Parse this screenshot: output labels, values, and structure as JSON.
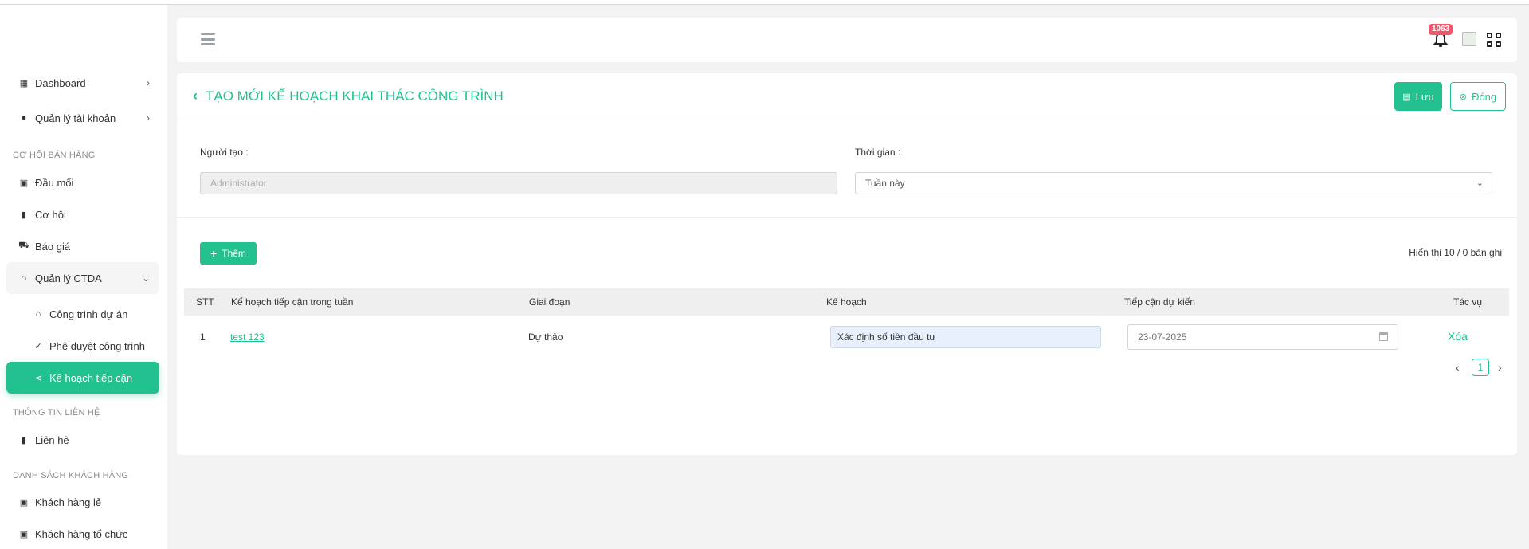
{
  "sidebar": {
    "items": [
      {
        "label": "Dashboard",
        "icon": "dashboard-icon"
      },
      {
        "label": "Quản lý tài khoản",
        "icon": "account-icon"
      }
    ],
    "sections": [
      {
        "title": "CƠ HỘI BÁN HÀNG"
      },
      {
        "title": "THÔNG TIN LIÊN HỆ"
      },
      {
        "title": "DANH SÁCH KHÁCH HÀNG"
      }
    ],
    "sales": [
      {
        "label": "Đầu mối",
        "icon": "contact-card-icon"
      },
      {
        "label": "Cơ hội",
        "icon": "building-icon"
      },
      {
        "label": "Báo giá",
        "icon": "cart-icon"
      },
      {
        "label": "Quản lý CTDA",
        "icon": "home-icon"
      }
    ],
    "ctda_sub": [
      {
        "label": "Công trình dự án",
        "icon": "home-icon"
      },
      {
        "label": "Phê duyệt công trình",
        "icon": "check-circle-icon"
      },
      {
        "label": "Kế hoạch tiếp cận",
        "icon": "share-icon"
      }
    ],
    "contact": [
      {
        "label": "Liên hệ",
        "icon": "building-icon"
      }
    ],
    "customers": [
      {
        "label": "Khách hàng lẻ",
        "icon": "contact-card-icon"
      },
      {
        "label": "Khách hàng tổ chức",
        "icon": "contact-card-icon"
      }
    ]
  },
  "header": {
    "notification_count": "1063"
  },
  "page": {
    "title": "TẠO MỚI KẾ HOẠCH KHAI THÁC CÔNG TRÌNH",
    "save_label": "Lưu",
    "close_label": "Đóng"
  },
  "form": {
    "creator_label": "Người tạo :",
    "creator_placeholder": "Administrator",
    "time_label": "Thời gian :",
    "time_value": "Tuần này"
  },
  "table": {
    "add_label": "Thêm",
    "count_text": "Hiển thị 10 / 0 bản ghi",
    "headers": [
      "STT",
      "Kế hoạch tiếp cận trong tuần",
      "Giai đoạn",
      "Kế hoạch",
      "Tiếp cận dự kiến",
      "Tác vụ"
    ],
    "rows": [
      {
        "stt": "1",
        "plan_name": "test 123",
        "stage": "Dự thảo",
        "plan": "Xác định số tiền đầu tư",
        "expected_date": "23-07-2025",
        "action": "Xóa"
      }
    ],
    "pagination": {
      "current_page": "1"
    }
  },
  "colors": {
    "accent": "#23c18f",
    "badge": "#f0566b"
  }
}
